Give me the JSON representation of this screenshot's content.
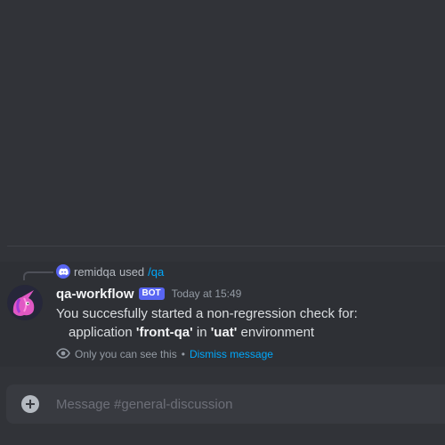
{
  "reply": {
    "user": "remidqa",
    "used_text": "used",
    "command": "/qa",
    "badge_icon": "discord-icon"
  },
  "message": {
    "author": "qa-workflow",
    "bot_tag": "BOT",
    "timestamp": "Today at 15:49",
    "line1": "You succesfully started a non-regression check for:",
    "line2_prefix": "application",
    "app_name": "'front-qa'",
    "line2_mid": "in",
    "env_name": "'uat'",
    "line2_suffix": "environment",
    "ephemeral_text": "Only you can see this",
    "separator": "•",
    "dismiss_label": "Dismiss message",
    "avatar_icon": "unicorn-avatar"
  },
  "composer": {
    "placeholder": "Message #general-discussion",
    "add_icon": "plus-circle-icon"
  },
  "colors": {
    "background": "#313338",
    "message_highlight": "#2e3035",
    "bot_tag": "#5865f2",
    "link": "#00a8fc"
  }
}
